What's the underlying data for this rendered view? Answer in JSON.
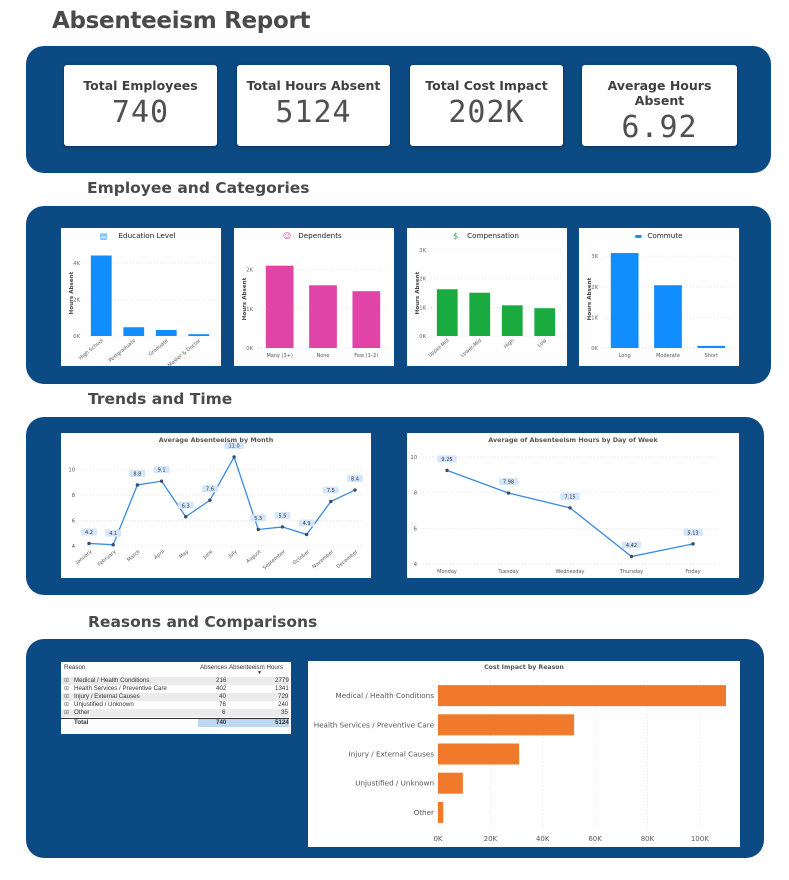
{
  "title": "Absenteeism Report",
  "sections": {
    "categories": "Employee and Categories",
    "trends": "Trends and Time",
    "reasons": "Reasons and Comparisons"
  },
  "kpis": [
    {
      "label": "Total Employees",
      "value": "740"
    },
    {
      "label": "Total Hours Absent",
      "value": "5124"
    },
    {
      "label": "Total Cost Impact",
      "value": "202K"
    },
    {
      "label": "Average Hours Absent",
      "value": "6.92"
    }
  ],
  "colors": {
    "panel": "#0c4a83",
    "blue": "#118dff",
    "pink": "#e044a7",
    "green": "#1aab40",
    "orange": "#f07a2a",
    "line": "#3a8be0"
  },
  "chart_data": [
    {
      "type": "bar",
      "title": "Education Level",
      "icon": "book-icon",
      "ylabel": "Hours Absent",
      "categories": [
        "High School",
        "Postgraduate",
        "Graduate",
        "Master & Doctor"
      ],
      "values": [
        4400,
        480,
        330,
        100
      ],
      "ylim": [
        0,
        4700
      ],
      "yticks": [
        {
          "v": 0,
          "label": "0K"
        },
        {
          "v": 2000,
          "label": "2K"
        },
        {
          "v": 4000,
          "label": "4K"
        }
      ],
      "color": "#118dff",
      "rotate": true
    },
    {
      "type": "bar",
      "title": "Dependents",
      "icon": "family-icon",
      "ylabel": "Hours Absent",
      "categories": [
        "Many (3+)",
        "None",
        "Few (1–2)"
      ],
      "values": [
        2100,
        1600,
        1450
      ],
      "ylim": [
        0,
        2500
      ],
      "yticks": [
        {
          "v": 0,
          "label": "0K"
        },
        {
          "v": 1000,
          "label": "1K"
        },
        {
          "v": 2000,
          "label": "2K"
        }
      ],
      "color": "#e044a7",
      "rotate": false
    },
    {
      "type": "bar",
      "title": "Compensation",
      "icon": "money-icon",
      "ylabel": "Hours Absent",
      "categories": [
        "Upper-Mid",
        "Lower-Mid",
        "High",
        "Low"
      ],
      "values": [
        1630,
        1510,
        1070,
        970
      ],
      "ylim": [
        0,
        3000
      ],
      "yticks": [
        {
          "v": 0,
          "label": "0K"
        },
        {
          "v": 1000,
          "label": "1K"
        },
        {
          "v": 2000,
          "label": "2K"
        },
        {
          "v": 3000,
          "label": "3K"
        }
      ],
      "color": "#1aab40",
      "rotate": true
    },
    {
      "type": "bar",
      "title": "Commute",
      "icon": "car-icon",
      "ylabel": "Hours Absent",
      "categories": [
        "Long",
        "Moderate",
        "Short"
      ],
      "values": [
        3100,
        2050,
        70
      ],
      "ylim": [
        0,
        3200
      ],
      "yticks": [
        {
          "v": 0,
          "label": "0K"
        },
        {
          "v": 1000,
          "label": "1K"
        },
        {
          "v": 2000,
          "label": "2K"
        },
        {
          "v": 3000,
          "label": "3K"
        }
      ],
      "color": "#118dff",
      "rotate": false
    },
    {
      "type": "line",
      "title": "Average Absenteeism by Month",
      "categories": [
        "January",
        "February",
        "March",
        "April",
        "May",
        "June",
        "July",
        "August",
        "September",
        "October",
        "November",
        "December"
      ],
      "values": [
        4.2,
        4.1,
        8.8,
        9.1,
        6.3,
        7.6,
        11.0,
        5.3,
        5.5,
        4.9,
        7.5,
        8.4
      ],
      "labels": [
        "4.2",
        "4.1",
        "8.8",
        "9.1",
        "6.3",
        "7.6",
        "11.0",
        "5.3",
        "5.5",
        "4.9",
        "7.5",
        "8.4"
      ],
      "ylim": [
        4,
        11
      ],
      "yticks": [
        4,
        6,
        8,
        10
      ],
      "color": "#3a8be0"
    },
    {
      "type": "line",
      "title": "Average of Absenteeism Hours by Day of Week",
      "categories": [
        "Monday",
        "Tuesday",
        "Wednesday",
        "Thursday",
        "Friday"
      ],
      "values": [
        9.25,
        7.98,
        7.15,
        4.42,
        5.13
      ],
      "labels": [
        "9.25",
        "7.98",
        "7.15",
        "4.42",
        "5.13"
      ],
      "ylim": [
        4,
        10
      ],
      "yticks": [
        4,
        6,
        8,
        10
      ],
      "color": "#3a8be0"
    },
    {
      "type": "bar",
      "orientation": "horizontal",
      "title": "Cost Impact by Reason",
      "categories": [
        "Medical / Health Conditions",
        "Health Services / Preventive Care",
        "Injury / External Causes",
        "Unjustified / Unknown",
        "Other"
      ],
      "values": [
        110000,
        52000,
        31000,
        9500,
        2000
      ],
      "xlim": [
        0,
        110000
      ],
      "xticks": [
        {
          "v": 0,
          "label": "0K"
        },
        {
          "v": 20000,
          "label": "20K"
        },
        {
          "v": 40000,
          "label": "40K"
        },
        {
          "v": 60000,
          "label": "60K"
        },
        {
          "v": 80000,
          "label": "80K"
        },
        {
          "v": 100000,
          "label": "100K"
        }
      ],
      "color": "#f07a2a"
    },
    {
      "type": "table",
      "columns": [
        "Reason",
        "Absences",
        "Absenteeism Hours"
      ],
      "rows": [
        [
          "Medical / Health Conditions",
          "216",
          "2779"
        ],
        [
          "Health Services / Preventive Care",
          "402",
          "1341"
        ],
        [
          "Injury / External Causes",
          "40",
          "729"
        ],
        [
          "Unjustified / Unknown",
          "76",
          "240"
        ],
        [
          "Other",
          "6",
          "35"
        ]
      ],
      "total": [
        "Total",
        "740",
        "5124"
      ]
    }
  ]
}
